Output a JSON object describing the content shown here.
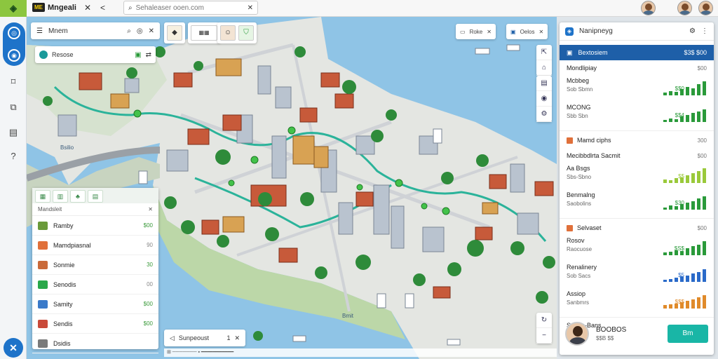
{
  "topbar": {
    "logo_glyph": "◈",
    "brand_mark": "ME",
    "brand_name": "Mngeali",
    "close_glyph": "✕",
    "back_glyph": "<",
    "search_placeholder": "Sehaleaser ooen.com"
  },
  "left_panel": {
    "title": "Mnem",
    "card_label": "Resose",
    "layer_header": "Mandsleit",
    "layers": [
      {
        "name": "Ramby",
        "value": "$00",
        "color": "#6a9a3a"
      },
      {
        "name": "Mamdpiasnal",
        "value": "90",
        "color": "#e0703a"
      },
      {
        "name": "Sonmie",
        "value": "30",
        "color": "#c96a3a"
      },
      {
        "name": "Senodis",
        "value": "00",
        "color": "#2aa84a"
      },
      {
        "name": "Samity",
        "value": "$00",
        "color": "#3a7ac9"
      },
      {
        "name": "Sendis",
        "value": "$00",
        "color": "#c94a3a"
      },
      {
        "name": "Dsidis",
        "value": "",
        "color": "#7a7a7a"
      }
    ]
  },
  "map": {
    "chip1": "Roke",
    "chip2": "Oelos",
    "bottom_search": "Sunpeoust",
    "bottom_num": "1",
    "water_label": "Bmit",
    "side_label": "Bsilio"
  },
  "right_panel": {
    "title": "Nanipneyg",
    "selected": {
      "label": "Bextosiem",
      "value": "$3$ $00"
    },
    "section1": {
      "title": "Mondlipiay",
      "count": "$00"
    },
    "metrics1": [
      {
        "label": "Mcbbeg",
        "sub": "Sob Sbmn",
        "value": "$$0",
        "color": "#2a9a3a"
      },
      {
        "label": "MCONG",
        "sub": "Sbb Sbn",
        "value": "$$4",
        "color": "#2a9a3a"
      }
    ],
    "section2": {
      "title": "Mamd ciphs",
      "count": "300",
      "color": "#e0703a"
    },
    "section2b": {
      "title": "Mecibbdlrta Sacmit",
      "count": "$00"
    },
    "metrics2": [
      {
        "label": "Aa Bsgs",
        "sub": "Sbs-Sbno",
        "value": "$$",
        "color": "#9ac93a"
      },
      {
        "label": "Benmalng",
        "sub": "Saobolins",
        "value": "$30",
        "color": "#2a9a3a"
      }
    ],
    "section3": {
      "title": "Selvaset",
      "count": "$00",
      "color": "#e0703a"
    },
    "metrics3": [
      {
        "label": "Rosov",
        "sub": "Raocuose",
        "value": "$S$",
        "color": "#2a9a3a"
      },
      {
        "label": "Renalinery",
        "sub": "Sob Sacs",
        "value": "$5",
        "color": "#2a6ac9"
      },
      {
        "label": "Assiop",
        "sub": "Sanbmrs",
        "value": "$$$",
        "color": "#e08a2a"
      }
    ],
    "footer_title": "Sonda-Bans",
    "profile": {
      "name": "BOOBOS",
      "sub": "$$B $$",
      "button": "Bm"
    }
  }
}
